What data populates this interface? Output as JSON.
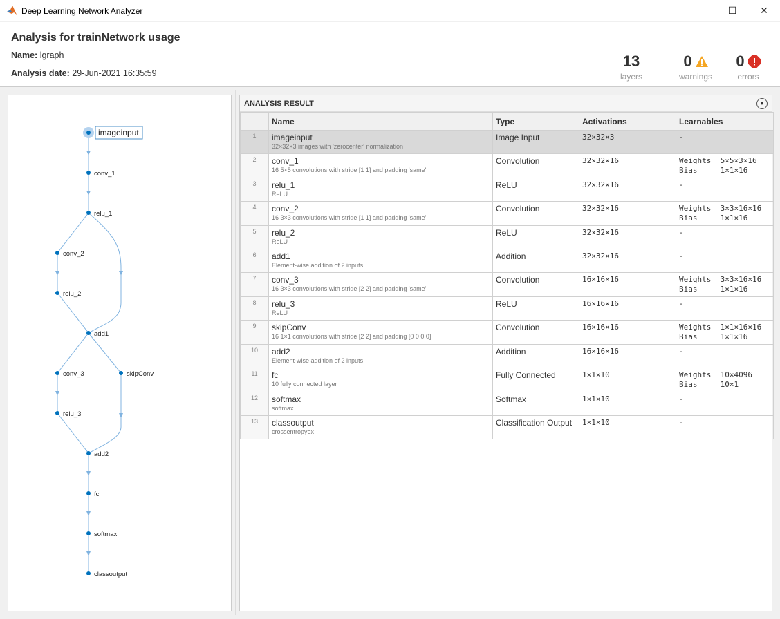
{
  "window": {
    "title": "Deep Learning Network Analyzer",
    "minimize": "—",
    "maximize": "☐",
    "close": "✕"
  },
  "header": {
    "title": "Analysis for trainNetwork usage",
    "name_label": "Name:",
    "name_value": "lgraph",
    "date_label": "Analysis date:",
    "date_value": "29-Jun-2021 16:35:59"
  },
  "stats": {
    "layers": {
      "value": "13",
      "label": "layers"
    },
    "warnings": {
      "value": "0",
      "label": "warnings"
    },
    "errors": {
      "value": "0",
      "label": "errors"
    }
  },
  "colors": {
    "accent": "#0072bd",
    "edge": "#80b3e0",
    "warning": "#f5a623",
    "error": "#d93025"
  },
  "result": {
    "title": "ANALYSIS RESULT",
    "columns": [
      "Name",
      "Type",
      "Activations",
      "Learnables"
    ],
    "rows": [
      {
        "idx": "1",
        "name": "imageinput",
        "desc": "32×32×3 images with 'zerocenter' normalization",
        "type": "Image Input",
        "act": "32×32×3",
        "learn": "-"
      },
      {
        "idx": "2",
        "name": "conv_1",
        "desc": "16 5×5 convolutions with stride [1  1] and padding 'same'",
        "type": "Convolution",
        "act": "32×32×16",
        "learn": "Weights  5×5×3×16\nBias     1×1×16"
      },
      {
        "idx": "3",
        "name": "relu_1",
        "desc": "ReLU",
        "type": "ReLU",
        "act": "32×32×16",
        "learn": "-"
      },
      {
        "idx": "4",
        "name": "conv_2",
        "desc": "16 3×3 convolutions with stride [1  1] and padding 'same'",
        "type": "Convolution",
        "act": "32×32×16",
        "learn": "Weights  3×3×16×16\nBias     1×1×16"
      },
      {
        "idx": "5",
        "name": "relu_2",
        "desc": "ReLU",
        "type": "ReLU",
        "act": "32×32×16",
        "learn": "-"
      },
      {
        "idx": "6",
        "name": "add1",
        "desc": "Element-wise addition of 2 inputs",
        "type": "Addition",
        "act": "32×32×16",
        "learn": "-"
      },
      {
        "idx": "7",
        "name": "conv_3",
        "desc": "16 3×3 convolutions with stride [2  2] and padding 'same'",
        "type": "Convolution",
        "act": "16×16×16",
        "learn": "Weights  3×3×16×16\nBias     1×1×16"
      },
      {
        "idx": "8",
        "name": "relu_3",
        "desc": "ReLU",
        "type": "ReLU",
        "act": "16×16×16",
        "learn": "-"
      },
      {
        "idx": "9",
        "name": "skipConv",
        "desc": "16 1×1 convolutions with stride [2  2] and padding [0  0  0  0]",
        "type": "Convolution",
        "act": "16×16×16",
        "learn": "Weights  1×1×16×16\nBias     1×1×16"
      },
      {
        "idx": "10",
        "name": "add2",
        "desc": "Element-wise addition of 2 inputs",
        "type": "Addition",
        "act": "16×16×16",
        "learn": "-"
      },
      {
        "idx": "11",
        "name": "fc",
        "desc": "10 fully connected layer",
        "type": "Fully Connected",
        "act": "1×1×10",
        "learn": "Weights  10×4096\nBias     10×1"
      },
      {
        "idx": "12",
        "name": "softmax",
        "desc": "softmax",
        "type": "Softmax",
        "act": "1×1×10",
        "learn": "-"
      },
      {
        "idx": "13",
        "name": "classoutput",
        "desc": "crossentropyex",
        "type": "Classification Output",
        "act": "1×1×10",
        "learn": "-"
      }
    ]
  },
  "graph": {
    "nodes": [
      "imageinput",
      "conv_1",
      "relu_1",
      "conv_2",
      "relu_2",
      "add1",
      "conv_3",
      "relu_3",
      "skipConv",
      "add2",
      "fc",
      "softmax",
      "classoutput"
    ]
  }
}
